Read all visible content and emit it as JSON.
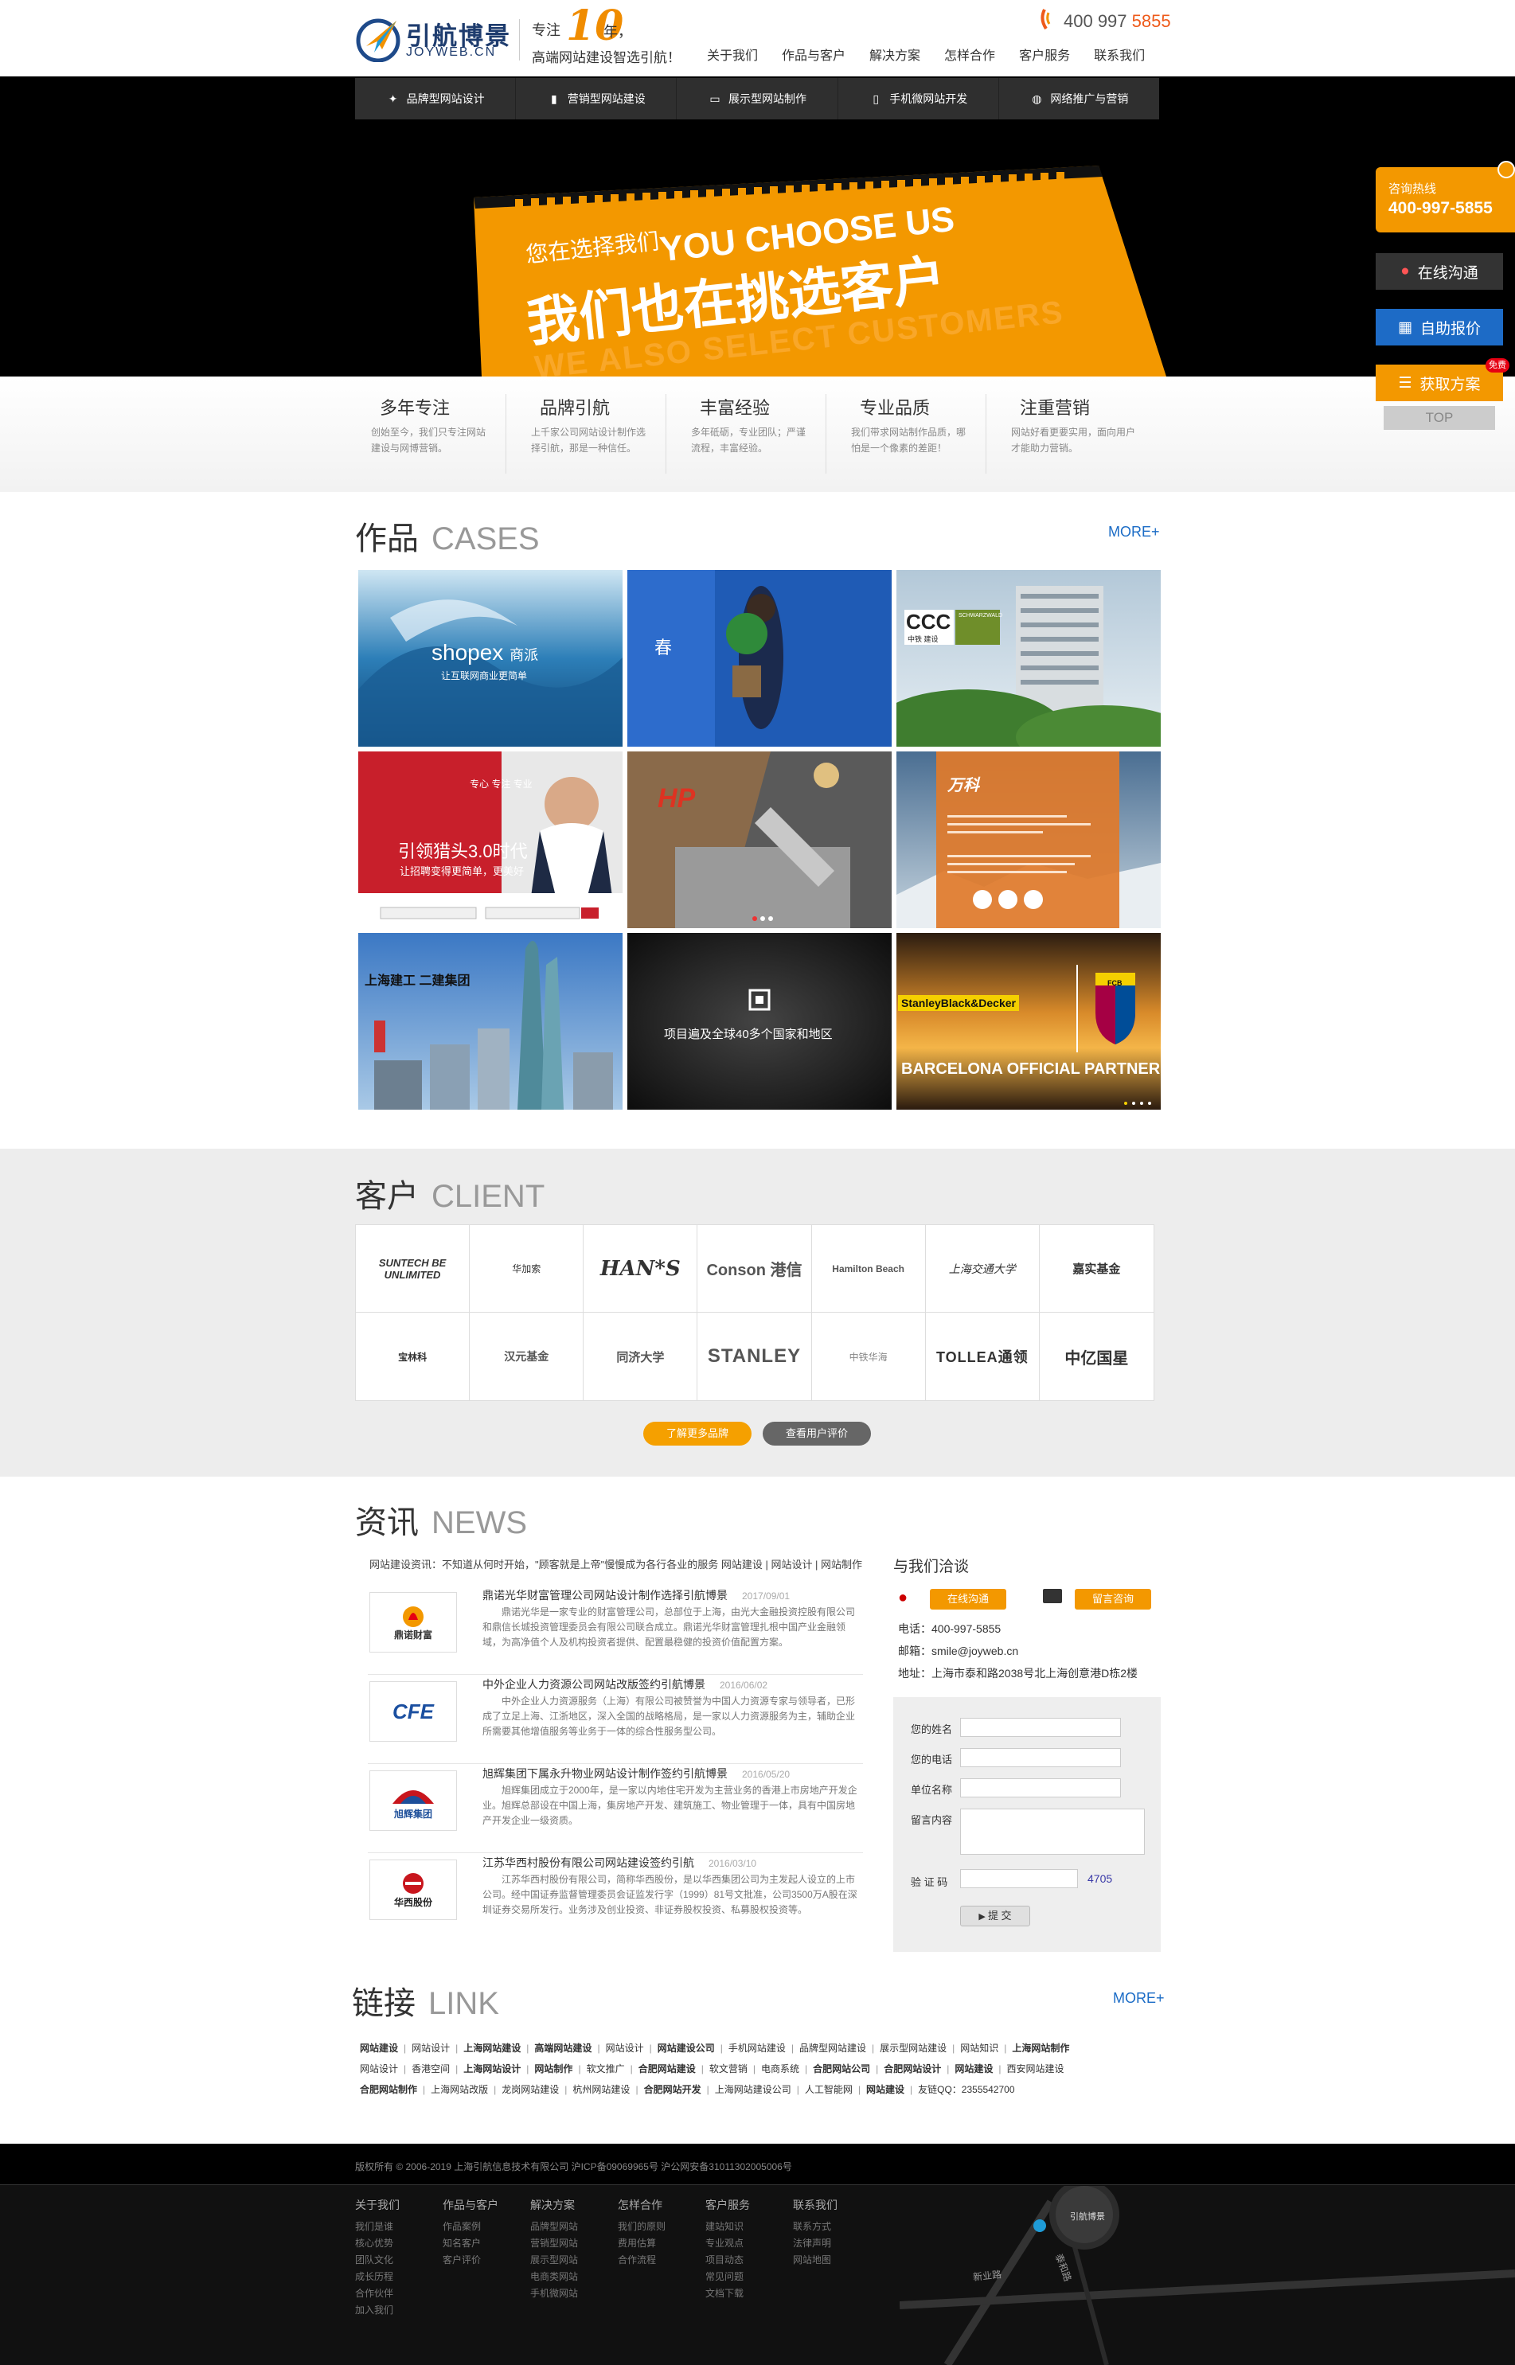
{
  "header": {
    "logo_cn": "引航博景",
    "logo_en": "JOYWEB.CN",
    "slogan_prefix": "专注",
    "slogan_num": "10",
    "slogan_suffix": "年，",
    "slogan_line2": "高端网站建设智选引航！",
    "phone_main": "400 997 ",
    "phone_accent": "5855",
    "nav": [
      "关于我们",
      "作品与客户",
      "解决方案",
      "怎样合作",
      "客户服务",
      "联系我们"
    ]
  },
  "subnav": [
    {
      "icon": "lightbulb-icon",
      "glyph": "💡",
      "label": "品牌型网站设计"
    },
    {
      "icon": "bar-chart-icon",
      "glyph": "▮",
      "label": "营销型网站建设"
    },
    {
      "icon": "monitor-icon",
      "glyph": "▭",
      "label": "展示型网站制作"
    },
    {
      "icon": "phone-icon",
      "glyph": "▯",
      "label": "手机微网站开发"
    },
    {
      "icon": "globe-icon",
      "glyph": "◍",
      "label": "网络推广与营销"
    }
  ],
  "banner": {
    "cn_small": "您在选择我们",
    "en_big": "YOU CHOOSE US",
    "cn_big": "我们也在挑选客户",
    "en_sub": "WE ALSO SELECT CUSTOMERS"
  },
  "features": [
    {
      "title": "多年专注",
      "desc": "创始至今，我们只专注网站建设与网博营销。"
    },
    {
      "title": "品牌引航",
      "desc": "上千家公司网站设计制作选择引航，那是一种信任。"
    },
    {
      "title": "丰富经验",
      "desc": "多年砥砺，专业团队；严谨流程，丰富经验。"
    },
    {
      "title": "专业品质",
      "desc": "我们带求网站制作品质，哪怕是一个像素的差距！"
    },
    {
      "title": "注重营销",
      "desc": "网站好看更要实用，面向用户才能助力营销。"
    }
  ],
  "cases": {
    "title_cn": "作品",
    "title_en": "CASES",
    "more": "MORE+",
    "tiles": {
      "shopex_brand": "shopex",
      "shopex_cn": "商派",
      "shopex_sub": "让互联网商业更简单",
      "spring_char": "春",
      "ccc": "CCC",
      "ccc_sub": "中铁 建设",
      "ccc_tag": "SCHWARZWALD",
      "hr_cn": "引领猎头3.0时代",
      "hr_sub": "让招聘变得更简单，更美好",
      "hr_top": "专心  专注  专业",
      "vanke": "万科",
      "jg_text": "项目遍及全球40多个国家和地区",
      "sj_brand": "上海建工  二建集团",
      "sbd": "StanleyBlack&Decker",
      "barca": "BARCELONA OFFICIAL PARTNER",
      "barca_badge": "FCB"
    }
  },
  "clients": {
    "title_cn": "客户",
    "title_en": "CLIENT",
    "logos": [
      "SUNTECH BE UNLIMITED",
      "华加索",
      "HAN*S",
      "Conson 港信",
      "Hamilton Beach",
      "上海交通大学",
      "嘉实基金",
      "宝林科",
      "汉元基金",
      "同济大学",
      "STANLEY",
      "中铁华海",
      "TOLLEA通领",
      "中亿国星"
    ],
    "btn_more": "了解更多品牌",
    "btn_review": "查看用户评价"
  },
  "news": {
    "title_cn": "资讯",
    "title_en": "NEWS",
    "marquee": "网站建设资讯：不知道从何时开始，\"顾客就是上帝\"慢慢成为各行各业的服务  网站建设 | 网站设计 | 网站制作",
    "items": [
      {
        "logo": "鼎诺财富",
        "title": "鼎诺光华财富管理公司网站设计制作选择引航博景",
        "date": "2017/09/01",
        "body": "鼎诺光华是一家专业的财富管理公司，总部位于上海，由光大金融投资控股有限公司和鼎信长城投资管理委员会有限公司联合成立。鼎诺光华财富管理扎根中国产业金融领域，为高净值个人及机构投资者提供、配置最稳健的投资价值配置方案。"
      },
      {
        "logo": "CFE",
        "title": "中外企业人力资源公司网站改版签约引航博景",
        "date": "2016/06/02",
        "body": "中外企业人力资源服务（上海）有限公司被赞誉为中国人力资源专家与领导者，已形成了立足上海、江浙地区，深入全国的战略格局，是一家以人力资源服务为主，辅助企业所需要其他增值服务等业务于一体的综合性服务型公司。"
      },
      {
        "logo": "旭辉集团",
        "title": "旭辉集团下属永升物业网站设计制作签约引航博景",
        "date": "2016/05/20",
        "body": "旭辉集团成立于2000年，是一家以内地住宅开发为主营业务的香港上市房地产开发企业。旭辉总部设在中国上海，集房地产开发、建筑施工、物业管理于一体，具有中国房地产开发企业一级资质。"
      },
      {
        "logo": "华西股份",
        "title": "江苏华西村股份有限公司网站建设签约引航",
        "date": "2016/03/10",
        "body": "江苏华西村股份有限公司，简称华西股份，是以华西集团公司为主发起人设立的上市公司。经中国证券监督管理委员会证监发行字（1999）81号文批准，公司3500万A股在深圳证券交易所发行。业务涉及创业投资、非证券股权投资、私募股权投资等。"
      }
    ]
  },
  "contact": {
    "title": "与我们洽谈",
    "btn_online": "在线沟通",
    "btn_message": "留言咨询",
    "tel": "电话：400-997-5855",
    "email": "邮箱：smile@joyweb.cn",
    "addr": "地址：上海市泰和路2038号北上海创意港D栋2楼",
    "form": {
      "name": "您的姓名",
      "phone": "您的电话",
      "company": "单位名称",
      "message": "留言内容",
      "captcha": "验 证 码",
      "captcha_code": "4705",
      "submit": "提 交"
    }
  },
  "links": {
    "title_cn": "链接",
    "title_en": "LINK",
    "more": "MORE+",
    "rows": [
      [
        "网站建设",
        "网站设计",
        "上海网站建设",
        "高端网站建设",
        "网站设计",
        "网站建设公司",
        "手机网站建设",
        "品牌型网站建设",
        "展示型网站建设",
        "网站知识",
        "上海网站制作"
      ],
      [
        "网站设计",
        "香港空间",
        "上海网站设计",
        "网站制作",
        "软文推广",
        "合肥网站建设",
        "软文营销",
        "电商系统",
        "合肥网站公司",
        "合肥网站设计",
        "网站建设",
        "西安网站建设"
      ],
      [
        "合肥网站制作",
        "上海网站改版",
        "龙岗网站建设",
        "杭州网站建设",
        "合肥网站开发",
        "上海网站建设公司",
        "人工智能网",
        "网站建设",
        "友链QQ：2355542700"
      ]
    ]
  },
  "footer": {
    "copyright": "版权所有 © 2006-2019 上海引航信息技术有限公司  沪ICP备09069965号  沪公网安备31011302005006号",
    "columns": [
      {
        "h": "关于我们",
        "items": [
          "我们是谁",
          "核心优势",
          "团队文化",
          "成长历程",
          "合作伙伴",
          "加入我们"
        ]
      },
      {
        "h": "作品与客户",
        "items": [
          "作品案例",
          "知名客户",
          "客户评价"
        ]
      },
      {
        "h": "解决方案",
        "items": [
          "品牌型网站",
          "营销型网站",
          "展示型网站",
          "电商类网站",
          "手机微网站"
        ]
      },
      {
        "h": "怎样合作",
        "items": [
          "我们的原则",
          "费用估算",
          "合作流程"
        ]
      },
      {
        "h": "客户服务",
        "items": [
          "建站知识",
          "专业观点",
          "项目动态",
          "常见问题",
          "文档下载"
        ]
      },
      {
        "h": "联系我们",
        "items": [
          "联系方式",
          "法律声明",
          "网站地图"
        ]
      }
    ],
    "map_road1": "新业路",
    "map_road2": "泰和路"
  },
  "float": {
    "hotline_label": "咨询热线",
    "hotline": "400-997-5855",
    "online": "在线沟通",
    "quote": "自助报价",
    "plan": "获取方案",
    "free": "免费",
    "top": "TOP"
  }
}
